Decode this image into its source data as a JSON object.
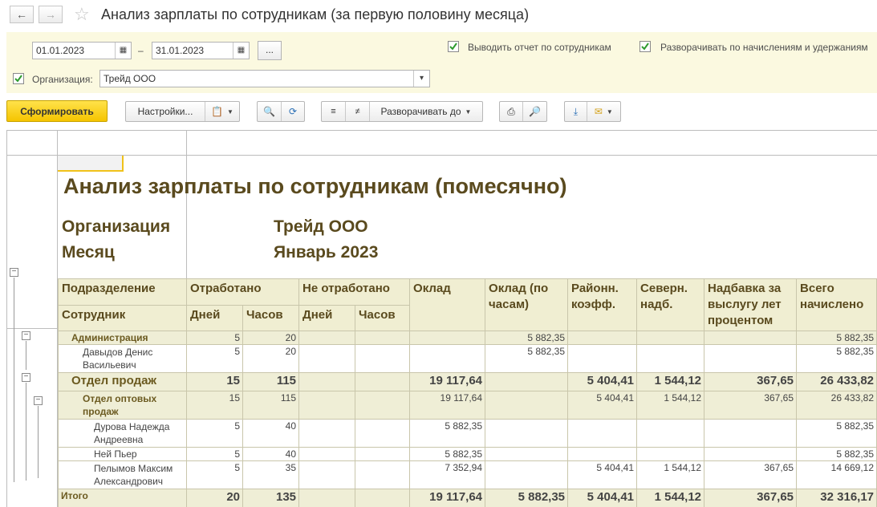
{
  "window": {
    "title": "Анализ зарплаты по сотрудникам (за первую половину месяца)"
  },
  "params": {
    "date_from": "01.01.2023",
    "date_separator": "–",
    "date_to": "31.01.2023",
    "period_button": "...",
    "show_by_employees": "Выводить отчет по сотрудникам",
    "expand_by_accruals": "Разворачивать по начислениям и удержаниям",
    "organization_label": "Организация:",
    "organization_value": "Трейд ООО"
  },
  "toolbar": {
    "generate": "Сформировать",
    "settings": "Настройки...",
    "expand_to": "Разворачивать до"
  },
  "report": {
    "title": "Анализ зарплаты по сотрудникам (помесячно)",
    "org_label": "Организация",
    "org_value": "Трейд ООО",
    "month_label": "Месяц",
    "month_value": "Январь 2023",
    "headers": {
      "department": "Подразделение",
      "employee": "Сотрудник",
      "worked": "Отработано",
      "not_worked": "Не отработано",
      "days": "Дней",
      "hours": "Часов",
      "salary": "Оклад",
      "salary_hours": "Оклад (по часам)",
      "regional": "Районн. коэфф.",
      "northern": "Северн. надб.",
      "seniority": "Надбавка за выслугу лет процентом",
      "total": "Всего начислено"
    },
    "rows": [
      {
        "name": "Администрация",
        "days": "5",
        "hours": "20",
        "salary": "",
        "salary_hours": "5 882,35",
        "regional": "",
        "northern": "",
        "seniority": "",
        "total": "5 882,35"
      },
      {
        "name": "Давыдов Денис Васильевич",
        "days": "5",
        "hours": "20",
        "salary": "",
        "salary_hours": "5 882,35",
        "regional": "",
        "northern": "",
        "seniority": "",
        "total": "5 882,35"
      },
      {
        "name": "Отдел продаж",
        "days": "15",
        "hours": "115",
        "salary": "19 117,64",
        "salary_hours": "",
        "regional": "5 404,41",
        "northern": "1 544,12",
        "seniority": "367,65",
        "total": "26 433,82"
      },
      {
        "name": "Отдел оптовых продаж",
        "days": "15",
        "hours": "115",
        "salary": "19 117,64",
        "salary_hours": "",
        "regional": "5 404,41",
        "northern": "1 544,12",
        "seniority": "367,65",
        "total": "26 433,82"
      },
      {
        "name": "Дурова Надежда Андреевна",
        "days": "5",
        "hours": "40",
        "salary": "5 882,35",
        "salary_hours": "",
        "regional": "",
        "northern": "",
        "seniority": "",
        "total": "5 882,35"
      },
      {
        "name": "Ней Пьер",
        "days": "5",
        "hours": "40",
        "salary": "5 882,35",
        "salary_hours": "",
        "regional": "",
        "northern": "",
        "seniority": "",
        "total": "5 882,35"
      },
      {
        "name": "Пелымов Максим Александрович",
        "days": "5",
        "hours": "35",
        "salary": "7 352,94",
        "salary_hours": "",
        "regional": "5 404,41",
        "northern": "1 544,12",
        "seniority": "367,65",
        "total": "14 669,12"
      }
    ],
    "totals": {
      "name": "Итого",
      "days": "20",
      "hours": "135",
      "salary": "19 117,64",
      "salary_hours": "5 882,35",
      "regional": "5 404,41",
      "northern": "1 544,12",
      "seniority": "367,65",
      "total": "32 316,17"
    }
  }
}
